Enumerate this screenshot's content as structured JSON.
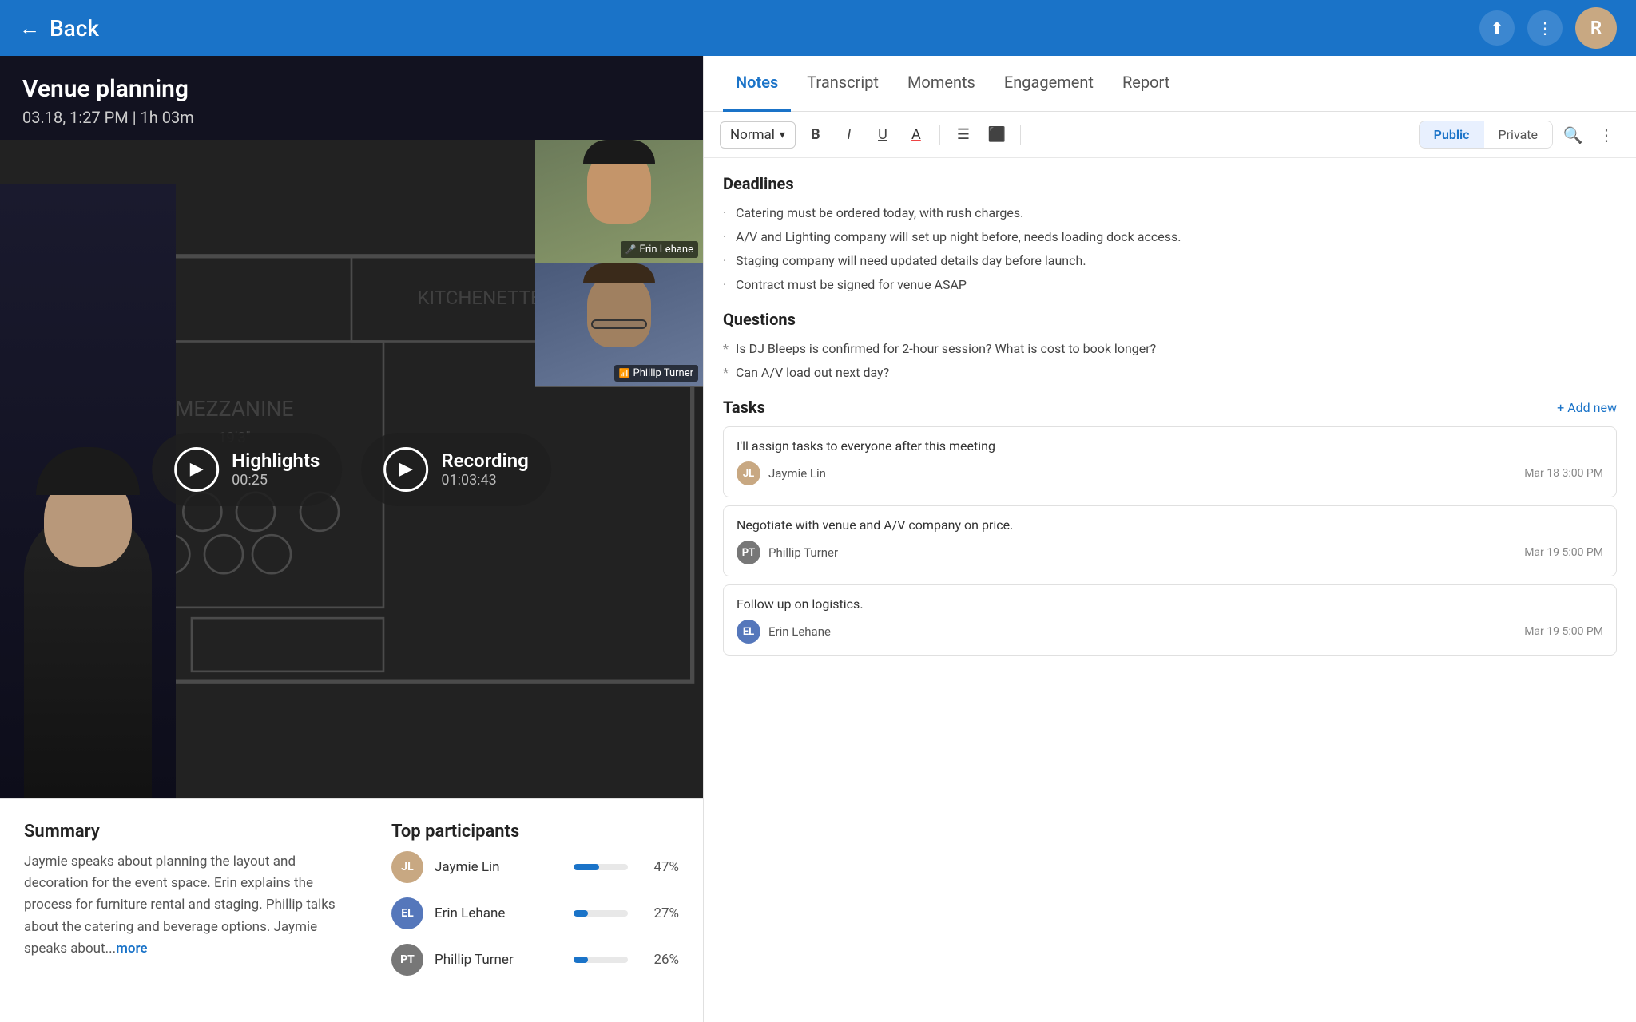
{
  "topbar": {
    "back_label": "Back",
    "share_icon": "⬆",
    "more_icon": "⋮",
    "avatar_initial": "R"
  },
  "meeting": {
    "title": "Venue planning",
    "meta": "03.18, 1:27 PM | 1h 03m"
  },
  "video": {
    "highlights": {
      "label": "Highlights",
      "duration": "00:25"
    },
    "recording": {
      "label": "Recording",
      "duration": "01:03:43"
    },
    "participants_overlay": [
      {
        "name": "Erin Lehane",
        "id": "erin"
      },
      {
        "name": "Phillip Turner",
        "id": "phillip"
      }
    ]
  },
  "summary": {
    "heading": "Summary",
    "text": "Jaymie speaks about planning the layout and decoration for the event space. Erin explains the process for furniture rental and staging. Phillip talks about the catering and beverage options. Jaymie speaks about...",
    "more_label": "more"
  },
  "participants": {
    "heading": "Top participants",
    "list": [
      {
        "name": "Jaymie Lin",
        "pct": 47,
        "pct_label": "47%",
        "initials": "JL",
        "color": "#c8a882"
      },
      {
        "name": "Erin Lehane",
        "pct": 27,
        "pct_label": "27%",
        "initials": "EL",
        "color": "#5577bb"
      },
      {
        "name": "Phillip Turner",
        "pct": 26,
        "pct_label": "26%",
        "initials": "PT",
        "color": "#777777"
      }
    ]
  },
  "right_panel": {
    "tabs": [
      {
        "id": "notes",
        "label": "Notes",
        "active": true
      },
      {
        "id": "transcript",
        "label": "Transcript",
        "active": false
      },
      {
        "id": "moments",
        "label": "Moments",
        "active": false
      },
      {
        "id": "engagement",
        "label": "Engagement",
        "active": false
      },
      {
        "id": "report",
        "label": "Report",
        "active": false
      }
    ],
    "toolbar": {
      "format": "Normal",
      "bold": "B",
      "italic": "I",
      "underline": "U",
      "color": "A",
      "list": "≡",
      "align": "≡",
      "visibility": {
        "public": "Public",
        "private": "Private"
      }
    },
    "notes": {
      "sections": [
        {
          "title": "Deadlines",
          "type": "bullets",
          "items": [
            "Catering must be ordered today, with rush charges.",
            "A/V and Lighting company will set up night before, needs loading dock access.",
            "Staging company will need updated details day before launch.",
            "Contract must be signed for venue ASAP"
          ]
        },
        {
          "title": "Questions",
          "type": "star-bullets",
          "items": [
            "Is DJ Bleeps is confirmed for 2-hour session? What is cost to book longer?",
            "Can A/V load out next day?"
          ]
        }
      ],
      "tasks": {
        "title": "Tasks",
        "add_label": "+ Add new",
        "items": [
          {
            "desc": "I'll assign tasks to everyone after this meeting",
            "assignee": "Jaymie Lin",
            "assignee_initials": "JL",
            "assignee_color": "#c8a882",
            "date": "Mar 18",
            "time": "3:00 PM"
          },
          {
            "desc": "Negotiate with venue and A/V company on price.",
            "assignee": "Phillip Turner",
            "assignee_initials": "PT",
            "assignee_color": "#777777",
            "date": "Mar 19",
            "time": "5:00 PM"
          },
          {
            "desc": "Follow up on logistics.",
            "assignee": "Erin Lehane",
            "assignee_initials": "EL",
            "assignee_color": "#5577bb",
            "date": "Mar 19",
            "time": "5:00 PM"
          }
        ]
      }
    }
  }
}
